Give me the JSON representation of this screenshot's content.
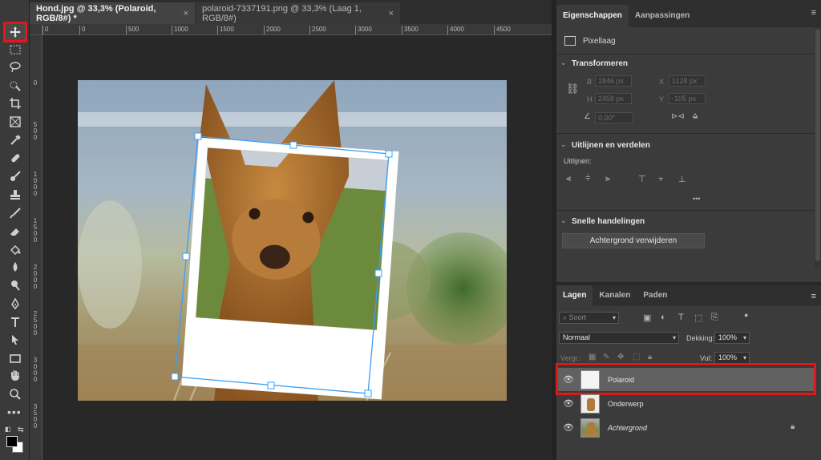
{
  "tabs": [
    {
      "label": "Hond.jpg @ 33,3% (Polaroid, RGB/8#) *",
      "close": "×"
    },
    {
      "label": "polaroid-7337191.png @ 33,3% (Laag 1, RGB/8#)",
      "close": "×"
    }
  ],
  "ruler_h": [
    "0",
    "0",
    "500",
    "1000",
    "1500",
    "2000",
    "2500",
    "3000",
    "3500",
    "4000",
    "4500"
  ],
  "ruler_v": [
    "0",
    "5 0 0",
    "1 0 0 0",
    "1 5 0 0",
    "2 0 0 0",
    "2 5 0 0",
    "3 0 0 0",
    "3 5 0 0"
  ],
  "tools": [
    "move-icon",
    "marquee-icon",
    "lasso-icon",
    "quick-select-icon",
    "crop-icon",
    "frame-icon",
    "eyedropper-icon",
    "healing-icon",
    "brush-icon",
    "stamp-icon",
    "history-brush-icon",
    "eraser-icon",
    "gradient-icon",
    "blur-icon",
    "dodge-icon",
    "pen-icon",
    "type-icon",
    "path-select-icon",
    "rectangle-icon",
    "hand-icon",
    "zoom-icon"
  ],
  "toolbar": {
    "more": "•••",
    "swap": "⇆"
  },
  "properties": {
    "tabs": [
      "Eigenschappen",
      "Aanpassingen"
    ],
    "layer_type": "Pixellaag",
    "transform": {
      "title": "Transformeren",
      "b_label": "B",
      "b_value": "1846 px",
      "x_label": "X",
      "x_value": "1128 px",
      "h_label": "H",
      "h_value": "2458 px",
      "y_label": "Y",
      "y_value": "-105 px",
      "angle": "0,00°"
    },
    "align": {
      "title": "Uitlijnen en verdelen",
      "subtitle": "Uitlijnen:",
      "more": "•••"
    },
    "quick": {
      "title": "Snelle handelingen",
      "button": "Achtergrond verwijderen"
    }
  },
  "layers_panel": {
    "tabs": [
      "Lagen",
      "Kanalen",
      "Paden"
    ],
    "search": "Soort",
    "blend": "Normaal",
    "opacity_label": "Dekking:",
    "opacity": "100%",
    "lock_label": "Vergr.:",
    "fill_label": "Vul:",
    "fill": "100%",
    "layers": [
      {
        "name": "Polaroid",
        "selected": true
      },
      {
        "name": "Onderwerp",
        "selected": false
      },
      {
        "name": "Achtergrond",
        "selected": false,
        "locked": true
      }
    ]
  },
  "colors": {
    "highlight": "#e01818",
    "panel": "#3b3b3b",
    "selection": "#616161",
    "handle": "#3a9ff5"
  }
}
